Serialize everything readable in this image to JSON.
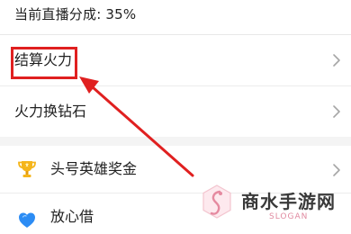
{
  "header": {
    "revenue_share_text": "当前直播分成: 35%"
  },
  "menu": {
    "settle_firepower": "结算火力",
    "exchange_firepower": "火力换钻石",
    "headline_hero_bonus": "头号英雄奖金",
    "fangxin_borrow": "放心借"
  },
  "icons": {
    "chevron": "chevron-right-icon",
    "trophy": "trophy-icon",
    "heart": "heart-icon",
    "highlight_color": "#e02020"
  },
  "watermark": {
    "title": "商水手游网",
    "subtitle": "SLOGAN"
  }
}
